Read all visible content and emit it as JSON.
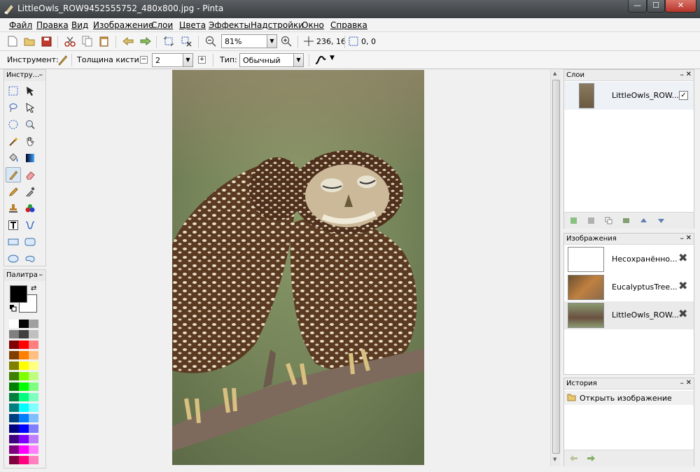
{
  "window": {
    "title": "LittleOwls_ROW9452555752_480x800.jpg - Pinta",
    "min": "—",
    "max": "☐",
    "close": "✕"
  },
  "menu": [
    "Файл",
    "Правка",
    "Вид",
    "Изображение",
    "Слои",
    "Цвета",
    "Эффекты",
    "Надстройки",
    "Окно",
    "Справка"
  ],
  "toolbar": {
    "zoom_value": "81%",
    "cursor_position": "236, 16",
    "selection_size": "0, 0"
  },
  "tool_options": {
    "tool_label": "Инструмент:",
    "brush_width_label": "Толщина кисти:",
    "brush_width_value": "2",
    "type_label": "Тип:",
    "type_value": "Обычный"
  },
  "tools_panel": {
    "title": "Инстру..."
  },
  "palette_panel": {
    "title": "Палитра"
  },
  "palette_colors": [
    [
      "#ffffff",
      "#000000",
      "#a0a0a0"
    ],
    [
      "#808080",
      "#404040",
      "#c0c0c0"
    ],
    [
      "#7f0000",
      "#ff0000",
      "#ff7f7f"
    ],
    [
      "#7f3f00",
      "#ff7f00",
      "#ffbf7f"
    ],
    [
      "#7f7f00",
      "#ffff00",
      "#ffff7f"
    ],
    [
      "#3f7f00",
      "#7fff00",
      "#bfff7f"
    ],
    [
      "#007f00",
      "#00ff00",
      "#7fff7f"
    ],
    [
      "#007f3f",
      "#00ff7f",
      "#7fffbf"
    ],
    [
      "#007f7f",
      "#00ffff",
      "#7fffff"
    ],
    [
      "#003f7f",
      "#007fff",
      "#7fbfff"
    ],
    [
      "#00007f",
      "#0000ff",
      "#7f7fff"
    ],
    [
      "#3f007f",
      "#7f00ff",
      "#bf7fff"
    ],
    [
      "#7f007f",
      "#ff00ff",
      "#ff7fff"
    ],
    [
      "#7f003f",
      "#ff007f",
      "#ff7fbf"
    ]
  ],
  "layers_panel": {
    "title": "Слои",
    "items": [
      {
        "name": "LittleOwls_ROW...",
        "visible": true
      }
    ]
  },
  "images_panel": {
    "title": "Изображения",
    "items": [
      {
        "name": "Несохранённо..."
      },
      {
        "name": "EucalyptusTree..."
      },
      {
        "name": "LittleOwls_ROW..."
      }
    ]
  },
  "history_panel": {
    "title": "История",
    "items": [
      {
        "name": "Открыть изображение"
      }
    ]
  },
  "colors": {
    "primary": "#000000",
    "secondary": "#ffffff",
    "accent": "#3a6ea5"
  }
}
